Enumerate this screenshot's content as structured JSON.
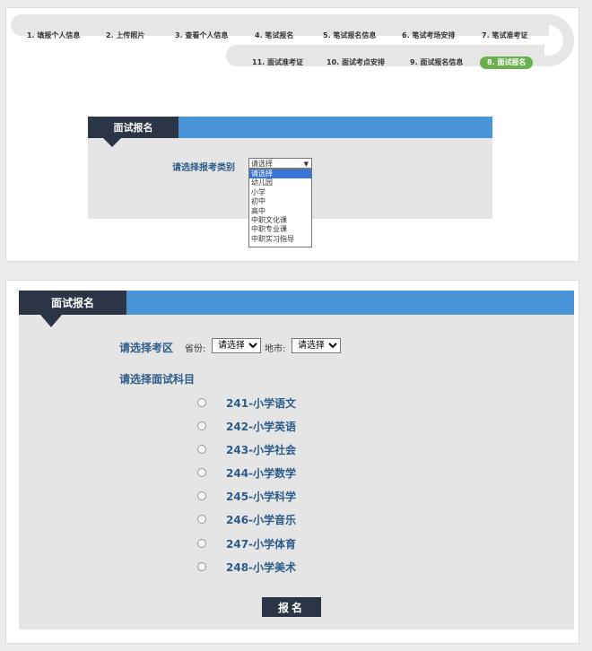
{
  "steps_top": [
    "1. 填报个人信息",
    "2. 上传照片",
    "3. 查看个人信息",
    "4. 笔试报名",
    "5. 笔试报名信息",
    "6. 笔试考场安排",
    "7. 笔试准考证"
  ],
  "steps_bottom": [
    "11. 面试准考证",
    "10. 面试考点安排",
    "9. 面试报名信息",
    "8. 面试报名"
  ],
  "panel1": {
    "tab_title": "面试报名",
    "category_label": "请选择报考类别",
    "category_value": "请选择",
    "category_options": [
      "请选择",
      "幼儿园",
      "小学",
      "初中",
      "高中",
      "中职文化课",
      "中职专业课",
      "中职实习指导"
    ]
  },
  "panel2": {
    "tab_title": "面试报名",
    "region_label": "请选择考区",
    "province_label": "省份:",
    "province_value": "请选择",
    "city_label": "地市:",
    "city_value": "请选择",
    "subject_label": "请选择面试科目",
    "subjects": [
      "241-小学语文",
      "242-小学英语",
      "243-小学社会",
      "244-小学数学",
      "245-小学科学",
      "246-小学音乐",
      "247-小学体育",
      "248-小学美术"
    ],
    "submit_label": "报名"
  },
  "colors": {
    "tab_dark": "#2c3545",
    "header_blue": "#4a93d6",
    "active_green": "#6ab04c",
    "label_blue": "#2d5c8a"
  }
}
